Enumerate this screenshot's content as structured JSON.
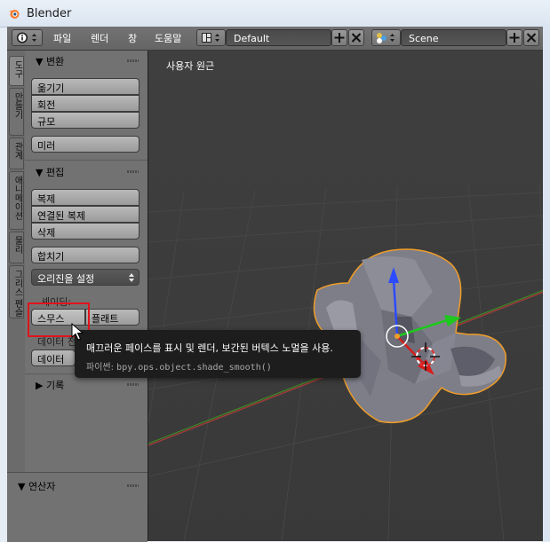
{
  "window": {
    "title": "Blender"
  },
  "header": {
    "menus": [
      "파일",
      "렌더",
      "창",
      "도움말"
    ],
    "layout_value": "Default",
    "scene_value": "Scene"
  },
  "tabs": [
    "도구",
    "만들기",
    "관계",
    "애니메이션",
    "물리",
    "그리스 펜슬"
  ],
  "shelf": {
    "transform": {
      "title": "▼ 변환",
      "buttons": [
        "옮기기",
        "회전",
        "규모"
      ],
      "mirror": "미러"
    },
    "edit": {
      "title": "▼ 편집",
      "buttons": [
        "복제",
        "연결된 복제",
        "삭제"
      ],
      "join": "합치기",
      "origin_dropdown": "오리진을 설정",
      "shading_label": "셰이딩:",
      "smooth": "스무스",
      "flat": "플래트",
      "data_partial_1": "데이터 전",
      "data_partial_2": "데이터"
    },
    "history": {
      "title": "▶ 기록"
    },
    "operator": {
      "title": "▼ 연산자"
    }
  },
  "viewport": {
    "label": "사용자 원근"
  },
  "tooltip": {
    "description": "매끄러운 페이스를 표시 및 렌더, 보간된 버텍스 노멀을 사용.",
    "python_label": "파이썬:",
    "python_call": "bpy.ops.object.shade_smooth()"
  },
  "colors": {
    "background": "#393939",
    "shelf": "#727272",
    "selection_outline": "#f09c28",
    "highlight": "#e0141b",
    "axis_x": "#d61d1d",
    "axis_y": "#1ec81e",
    "axis_z": "#2c4bff"
  }
}
